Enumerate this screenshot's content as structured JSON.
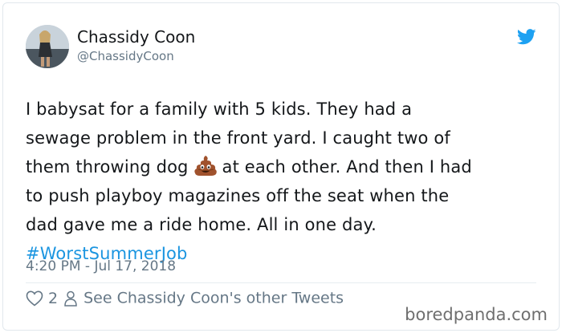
{
  "tweet": {
    "author_name": "Chassidy Coon",
    "author_handle": "@ChassidyCoon",
    "text_lines": [
      "I babysat for a family with 5 kids. They had a",
      "sewage problem in the front yard. I caught two of",
      "them throwing dog",
      "at each other. And then I had",
      "to push playboy magazines off the seat when the",
      "dad gave me a ride home. All in one day."
    ],
    "hashtag": "#WorstSummerJob",
    "timestamp": "4:20 PM - Jul 17, 2018",
    "likes": "2",
    "see_other_tweets": "See Chassidy Coon's other Tweets",
    "emoji": "pile-of-poo-icon"
  },
  "watermark": "boredpanda.com",
  "colors": {
    "link": "#1b95e0",
    "text": "#14171a",
    "muted": "#657786",
    "twitter_blue": "#1da1f2"
  }
}
